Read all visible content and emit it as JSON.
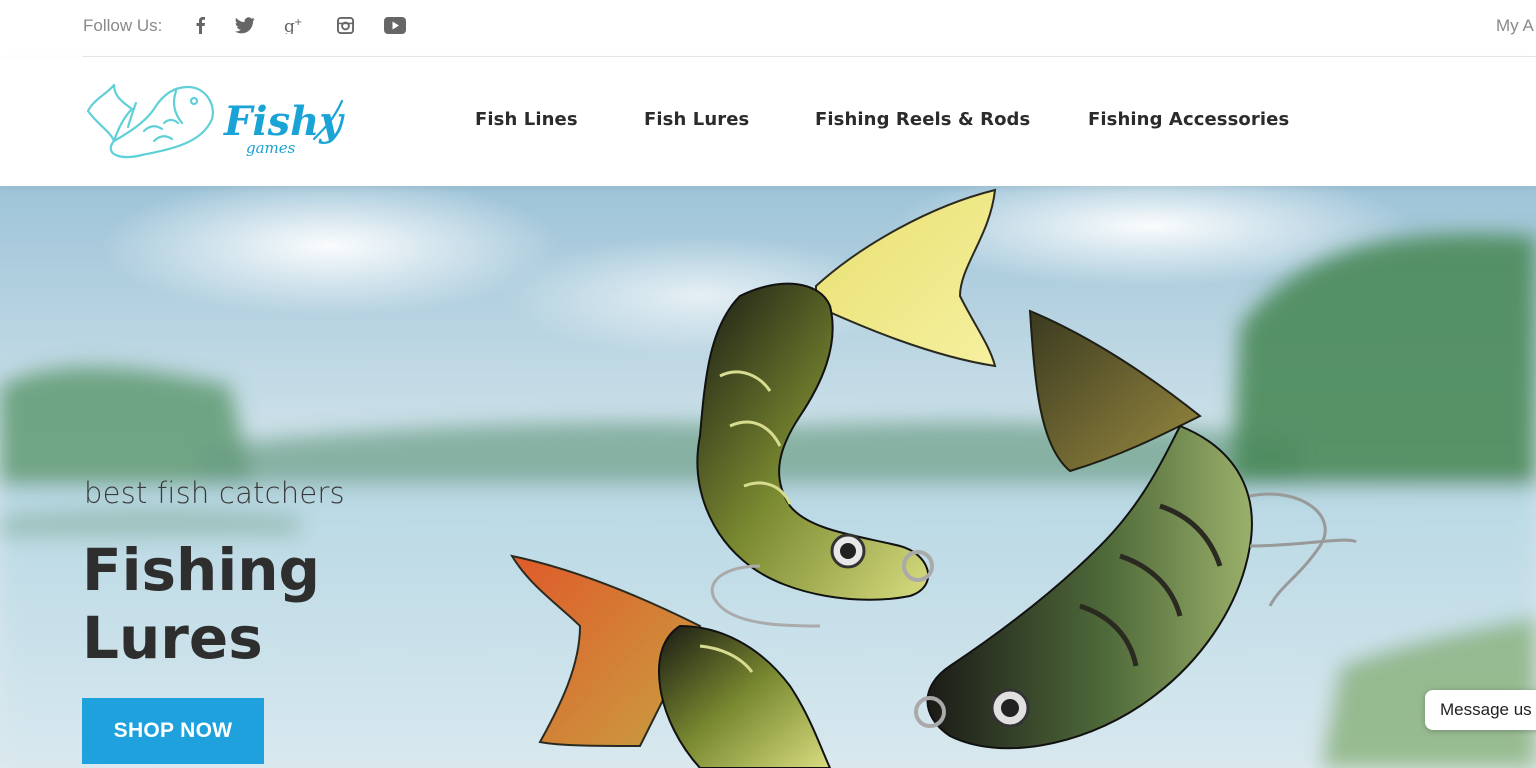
{
  "topbar": {
    "follow_label": "Follow Us:",
    "social_icons": [
      "facebook-icon",
      "twitter-icon",
      "google-plus-icon",
      "instagram-icon",
      "youtube-icon"
    ],
    "account_link": "My A"
  },
  "header": {
    "logo": {
      "word": "Fishy",
      "subword": "games",
      "color": "#1aa3d6"
    },
    "nav": [
      {
        "label": "Fish Lines"
      },
      {
        "label": "Fish Lures"
      },
      {
        "label": "Fishing Reels & Rods"
      },
      {
        "label": "Fishing Accessories"
      }
    ]
  },
  "hero": {
    "subtitle": "best fish catchers",
    "title": "Fishing Lures",
    "button_label": "SHOP NOW",
    "button_color": "#1ea1dc"
  },
  "chat": {
    "label": "Message us"
  }
}
